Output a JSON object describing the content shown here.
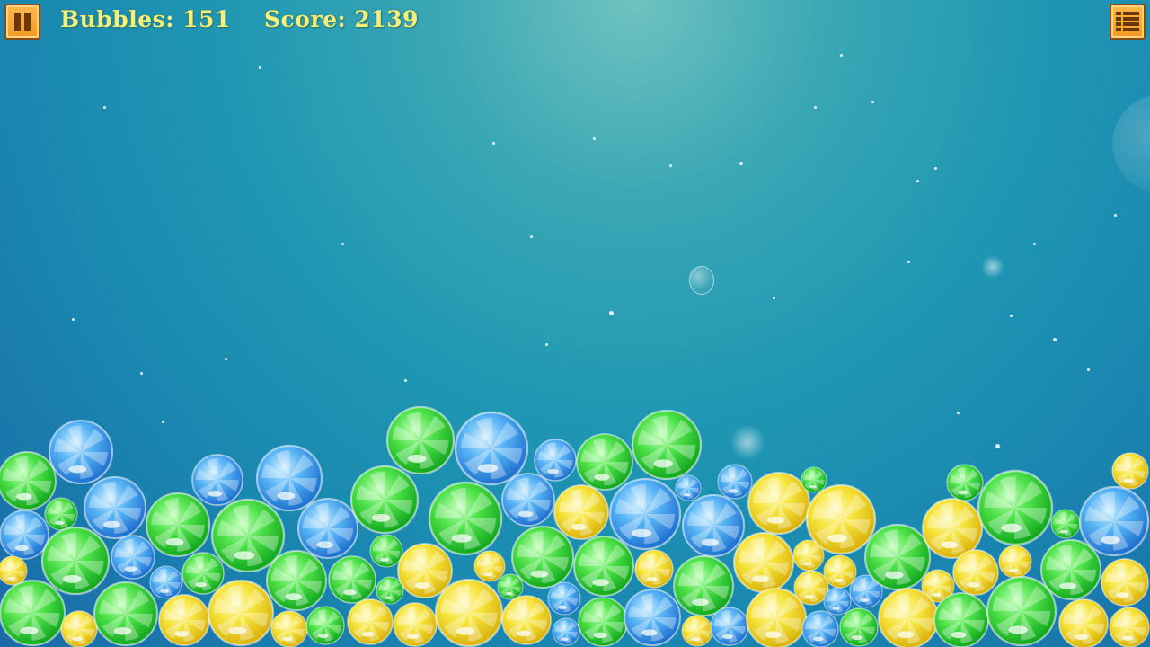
{
  "hud": {
    "bubbles_label": "Bubbles: 151",
    "score_label": "Score: 2139"
  },
  "icons": {
    "pause": "pause-icon",
    "menu": "menu-list-icon"
  },
  "colors": {
    "button_fill": "#f5a62f",
    "button_border": "#8a4b10",
    "hud_text": "#f5f07a",
    "green_bubble": "#2fd43b",
    "blue_bubble": "#3f9ff0",
    "yellow_bubble": "#f2e02c"
  },
  "candy_types": [
    "green",
    "blue",
    "yellow"
  ]
}
